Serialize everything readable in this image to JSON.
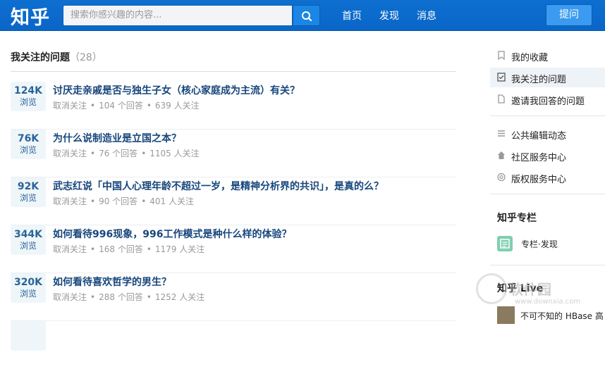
{
  "header": {
    "logo": "知乎",
    "search_placeholder": "搜索你感兴趣的内容...",
    "nav": [
      "首页",
      "发现",
      "消息"
    ],
    "ask_label": "提问"
  },
  "main": {
    "title": "我关注的问题",
    "count": "（28）",
    "questions": [
      {
        "views": "124K",
        "views_label": "浏览",
        "title": "讨厌走亲戚是否与独生子女（核心家庭成为主流）有关？",
        "unfollow": "取消关注",
        "answers": "104 个回答",
        "followers": "639 人关注"
      },
      {
        "views": "76K",
        "views_label": "浏览",
        "title": "为什么说制造业是立国之本？",
        "unfollow": "取消关注",
        "answers": "76 个回答",
        "followers": "1105 人关注"
      },
      {
        "views": "92K",
        "views_label": "浏览",
        "title": "武志红说「中国人心理年龄不超过一岁，是精神分析界的共识」，是真的么？",
        "unfollow": "取消关注",
        "answers": "90 个回答",
        "followers": "401 人关注"
      },
      {
        "views": "344K",
        "views_label": "浏览",
        "title": "如何看待996现象，996工作模式是种什么样的体验？",
        "unfollow": "取消关注",
        "answers": "168 个回答",
        "followers": "1179 人关注"
      },
      {
        "views": "320K",
        "views_label": "浏览",
        "title": "如何看待喜欢哲学的男生？",
        "unfollow": "取消关注",
        "answers": "288 个回答",
        "followers": "1252 人关注"
      }
    ]
  },
  "sidebar": {
    "items": [
      {
        "label": "我的收藏",
        "icon": "bookmark-icon"
      },
      {
        "label": "我关注的问题",
        "icon": "checkbox-icon"
      },
      {
        "label": "邀请我回答的问题",
        "icon": "document-icon"
      },
      {
        "label": "公共编辑动态",
        "icon": "list-icon"
      },
      {
        "label": "社区服务中心",
        "icon": "home-icon"
      },
      {
        "label": "版权服务中心",
        "icon": "copyright-icon"
      }
    ],
    "column_heading": "知乎专栏",
    "column_link": "专栏·发现",
    "live_heading": "知乎 Live",
    "live_item": "不可不知的 HBase 高"
  },
  "watermark": {
    "text": "软件园",
    "url": "www.downxia.com"
  },
  "colors": {
    "header": "#0a66c8",
    "link": "#17467b",
    "views_bg": "#eff6fa"
  }
}
